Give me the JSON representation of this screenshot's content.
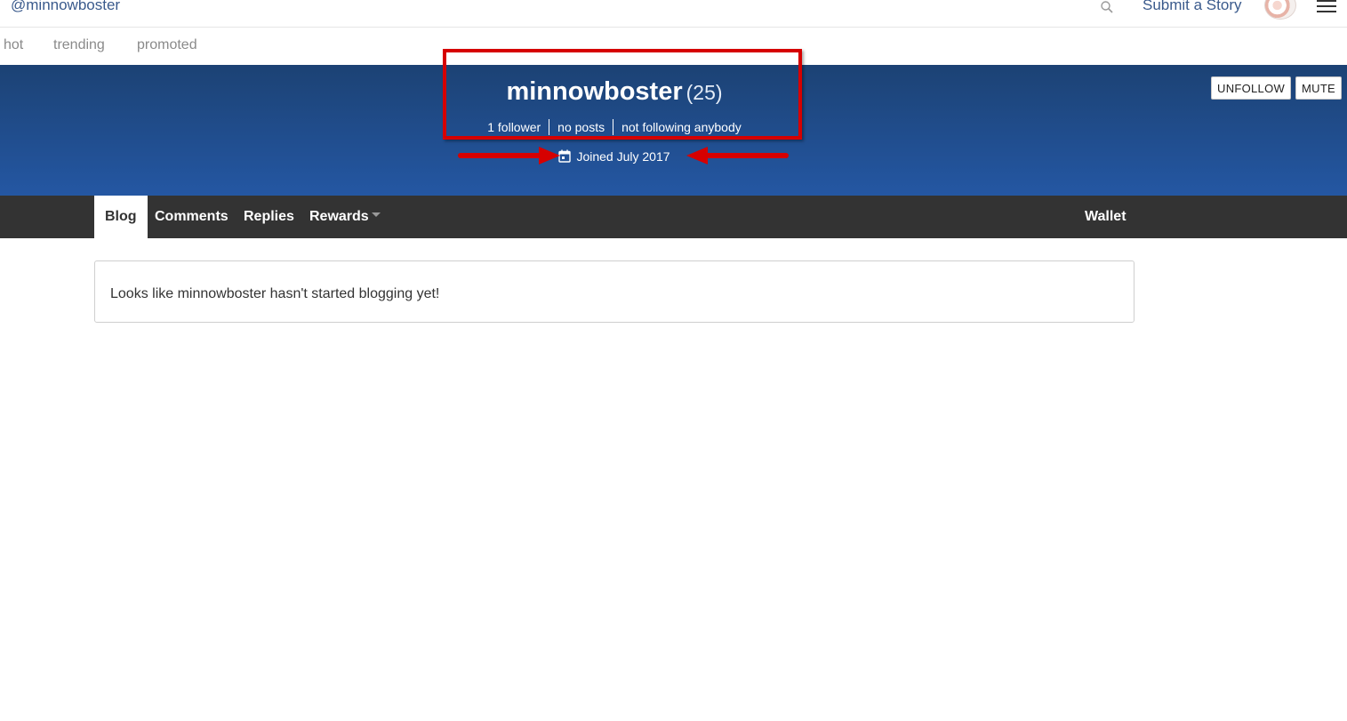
{
  "header": {
    "username": "@minnowboster",
    "submit_label": "Submit a Story",
    "icons": {
      "search": "search-icon",
      "menu": "hamburger-menu-icon",
      "avatar": "user-avatar"
    }
  },
  "sort_tabs": [
    {
      "label": "hot"
    },
    {
      "label": "trending"
    },
    {
      "label": "promoted"
    }
  ],
  "profile": {
    "name": "minnowboster",
    "reputation": "(25)",
    "stats": {
      "followers": "1 follower",
      "posts": "no posts",
      "following": "not following anybody"
    },
    "joined": "Joined July 2017",
    "joined_icon": "calendar-icon",
    "actions": {
      "unfollow": "UNFOLLOW",
      "mute": "MUTE"
    }
  },
  "profile_tabs": {
    "blog": "Blog",
    "comments": "Comments",
    "replies": "Replies",
    "rewards": "Rewards",
    "wallet": "Wallet",
    "active": "Blog"
  },
  "content": {
    "empty_message": "Looks like minnowboster hasn't started blogging yet!"
  },
  "colors": {
    "banner_top": "#1c4274",
    "banner_bottom": "#2457a3",
    "nav_bg": "#333333",
    "link": "#3a5a8c",
    "annotation": "#d60000"
  }
}
